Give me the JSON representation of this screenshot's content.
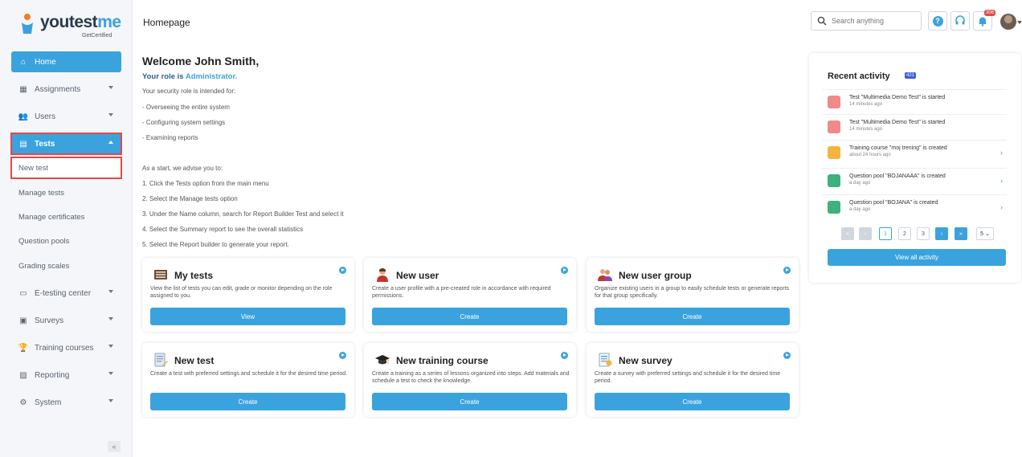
{
  "brand": {
    "name_prefix": "youtest",
    "name_suffix": "me",
    "tagline": "GetCertified"
  },
  "header": {
    "title": "Homepage",
    "search_placeholder": "Search anything",
    "notifications_count": "306"
  },
  "sidebar": {
    "items": [
      {
        "label": "Home"
      },
      {
        "label": "Assignments"
      },
      {
        "label": "Users"
      },
      {
        "label": "Tests"
      },
      {
        "label": "E-testing center"
      },
      {
        "label": "Surveys"
      },
      {
        "label": "Training courses"
      },
      {
        "label": "Reporting"
      },
      {
        "label": "System"
      }
    ],
    "tests_subitems": [
      {
        "label": "New test"
      },
      {
        "label": "Manage tests"
      },
      {
        "label": "Manage certificates"
      },
      {
        "label": "Question pools"
      },
      {
        "label": "Grading scales"
      }
    ],
    "collapse_symbol": "«"
  },
  "welcome": {
    "heading": "Welcome John Smith,",
    "role_prefix": "Your role is",
    "role_name": "Administrator.",
    "intro": "Your security role is intended for:",
    "duties": [
      "- Overseeing the entire system",
      "- Configuring system settings",
      "- Examining reports"
    ],
    "advice": "As a start, we advise you to:",
    "steps": [
      "1. Click the Tests option from the main menu",
      "2. Select the Manage tests option",
      "3. Under the Name column, search for Report Builder Test and select it",
      "4. Select the Summary report to see the overall statistics",
      "5. Select the Report builder to generate your report."
    ]
  },
  "cards": [
    {
      "title": "My tests",
      "desc": "View the list of tests you can edit, grade or monitor depending on the role assigned to you.",
      "button": "View",
      "icon": "tests-list-icon"
    },
    {
      "title": "New user",
      "desc": "Create a user profile with a pre-created role in accordance with required permissions.",
      "button": "Create",
      "icon": "user-icon"
    },
    {
      "title": "New user group",
      "desc": "Organize existing users in a group to easily schedule tests or generate reports for that group specifically.",
      "button": "Create",
      "icon": "user-group-icon"
    },
    {
      "title": "New test",
      "desc": "Create a test with preferred settings and schedule it for the desired time period.",
      "button": "Create",
      "icon": "new-test-icon"
    },
    {
      "title": "New training course",
      "desc": "Create a training as a series of lessons organized into steps. Add materials and schedule a test to check the knowledge.",
      "button": "Create",
      "icon": "graduation-cap-icon"
    },
    {
      "title": "New survey",
      "desc": "Create a survey with preferred settings and schedule it for the desired time period.",
      "button": "Create",
      "icon": "survey-icon"
    }
  ],
  "activity": {
    "title": "Recent activity",
    "count": "421",
    "items": [
      {
        "text": "Test \"Multimedia Demo Test\" is started",
        "time": "14 minutes ago",
        "color": "#f08a8a",
        "arrow": ""
      },
      {
        "text": "Test \"Multimedia Demo Test\" is started",
        "time": "14 minutes ago",
        "color": "#f08a8a",
        "arrow": ""
      },
      {
        "text": "Training course \"moj trening\" is created",
        "time": "about 24 hours ago",
        "color": "#f2b640",
        "arrow": "›"
      },
      {
        "text": "Question pool \"BOJANAAA\" is created",
        "time": "a day ago",
        "color": "#3fb07f",
        "arrow": "›"
      },
      {
        "text": "Question pool \"BOJANA\" is created",
        "time": "a day ago",
        "color": "#3fb07f",
        "arrow": "›"
      }
    ],
    "pagination": {
      "first": "«",
      "prev": "‹",
      "pages": [
        "1",
        "2",
        "3"
      ],
      "next": "›",
      "last": "»",
      "page_size": "5 ⌄"
    },
    "view_all": "View all activity"
  },
  "colors": {
    "accent": "#3aa3de",
    "highlight": "#e14a4a"
  }
}
